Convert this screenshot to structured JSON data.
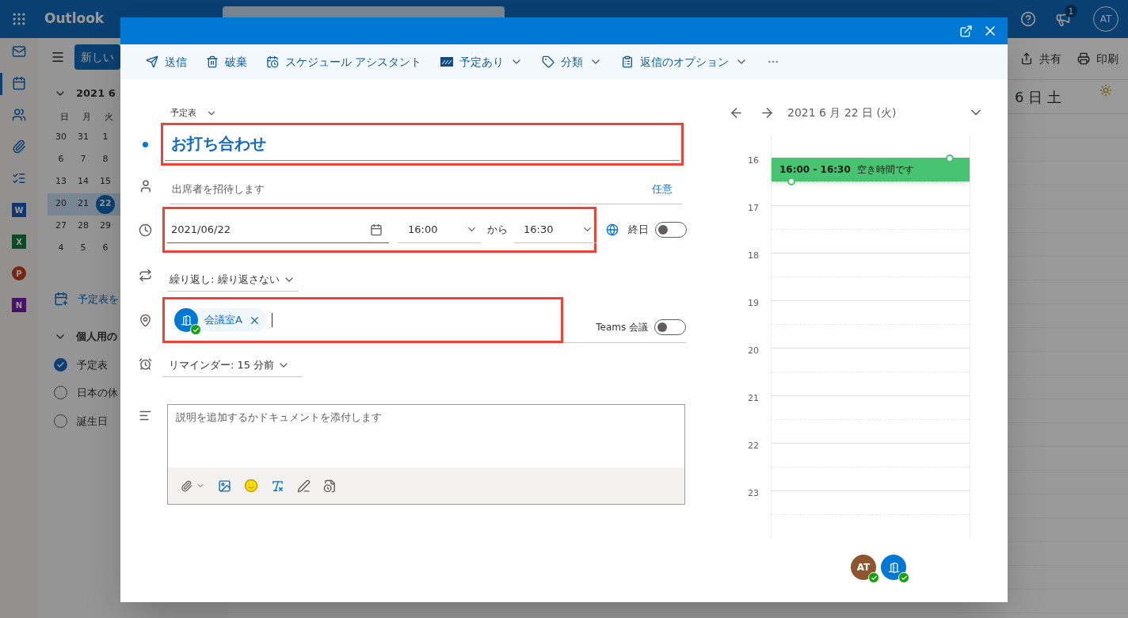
{
  "app": {
    "name": "Outlook",
    "notification_count": "1",
    "avatar": "AT"
  },
  "rail": [
    {
      "kind": "mail",
      "selected": false
    },
    {
      "kind": "calendar",
      "selected": true
    },
    {
      "kind": "people",
      "selected": false
    },
    {
      "kind": "files",
      "selected": false
    },
    {
      "kind": "todo",
      "selected": false
    },
    {
      "kind": "word",
      "letter": "W",
      "selected": false
    },
    {
      "kind": "excel",
      "letter": "X",
      "selected": false
    },
    {
      "kind": "powerpoint",
      "letter": "P",
      "selected": false
    },
    {
      "kind": "onenote",
      "letter": "N",
      "selected": false
    }
  ],
  "folder_pane": {
    "new_button": "新しい",
    "mini_calendar": {
      "title": "2021 6",
      "expanded": true,
      "weekdays": [
        "日",
        "月",
        "火"
      ],
      "weeks": [
        {
          "selected": false,
          "days": [
            {
              "label": "30",
              "selected": false
            },
            {
              "label": "31",
              "selected": false
            },
            {
              "label": "1",
              "selected": false
            }
          ]
        },
        {
          "selected": false,
          "days": [
            {
              "label": "6",
              "selected": false
            },
            {
              "label": "7",
              "selected": false
            },
            {
              "label": "8",
              "selected": false
            }
          ]
        },
        {
          "selected": false,
          "days": [
            {
              "label": "13",
              "selected": false
            },
            {
              "label": "14",
              "selected": false
            },
            {
              "label": "15",
              "selected": false
            }
          ]
        },
        {
          "selected": true,
          "days": [
            {
              "label": "20",
              "selected": false
            },
            {
              "label": "21",
              "selected": false
            },
            {
              "label": "22",
              "selected": true
            }
          ]
        },
        {
          "selected": false,
          "days": [
            {
              "label": "27",
              "selected": false
            },
            {
              "label": "28",
              "selected": false
            },
            {
              "label": "29",
              "selected": false
            }
          ]
        },
        {
          "selected": false,
          "days": [
            {
              "label": "4",
              "selected": false
            },
            {
              "label": "5",
              "selected": false
            },
            {
              "label": "6",
              "selected": false
            }
          ]
        }
      ]
    },
    "add_calendar": "予定表を",
    "group": {
      "label": "個人用の",
      "expanded": true,
      "items": [
        {
          "label": "予定表",
          "checked": true
        },
        {
          "label": "日本の休",
          "checked": false
        },
        {
          "label": "誕生日",
          "checked": false
        }
      ]
    }
  },
  "main": {
    "toolbar": [
      {
        "label": "共有",
        "kind": "share"
      },
      {
        "label": "印刷",
        "kind": "print"
      }
    ],
    "day_header": "6 日 土"
  },
  "dialog": {
    "toolbar": [
      {
        "label": "送信",
        "kind": "send",
        "dropdown": false
      },
      {
        "label": "破棄",
        "kind": "discard",
        "dropdown": false
      },
      {
        "label": "スケジュール アシスタント",
        "kind": "schedule",
        "dropdown": false
      },
      {
        "label": "予定あり",
        "kind": "busy",
        "dropdown": true
      },
      {
        "label": "分類",
        "kind": "tag",
        "dropdown": true
      },
      {
        "label": "返信のオプション",
        "kind": "reply",
        "dropdown": true
      }
    ],
    "form": {
      "calendar": "予定表",
      "title": {
        "value": "お打ち合わせ",
        "highlighted": true
      },
      "attendees": {
        "placeholder": "出席者を招待します",
        "optional_link": "任意"
      },
      "time": {
        "highlighted": true,
        "date": "2021/06/22",
        "start": "16:00",
        "separator": "から",
        "end": "16:30"
      },
      "all_day": {
        "label": "終日",
        "on": false
      },
      "recurrence": "繰り返し: 繰り返さない",
      "location": {
        "highlighted": true,
        "room": "会議室A",
        "accepted": true
      },
      "teams": {
        "label": "Teams 会議",
        "on": false
      },
      "reminder": "リマインダー: 15 分前",
      "description": {
        "placeholder": "説明を追加するかドキュメントを添付します"
      }
    },
    "scheduler": {
      "date": "2021 6 月 22 日 (火)",
      "hours": [
        "16",
        "17",
        "18",
        "19",
        "20",
        "21",
        "22",
        "23"
      ],
      "event": {
        "time": "16:00 - 16:30",
        "label": "空き時間です"
      },
      "attendees": [
        {
          "kind": "person",
          "initials": "AT",
          "accepted": true
        },
        {
          "kind": "room",
          "accepted": true
        }
      ]
    }
  }
}
